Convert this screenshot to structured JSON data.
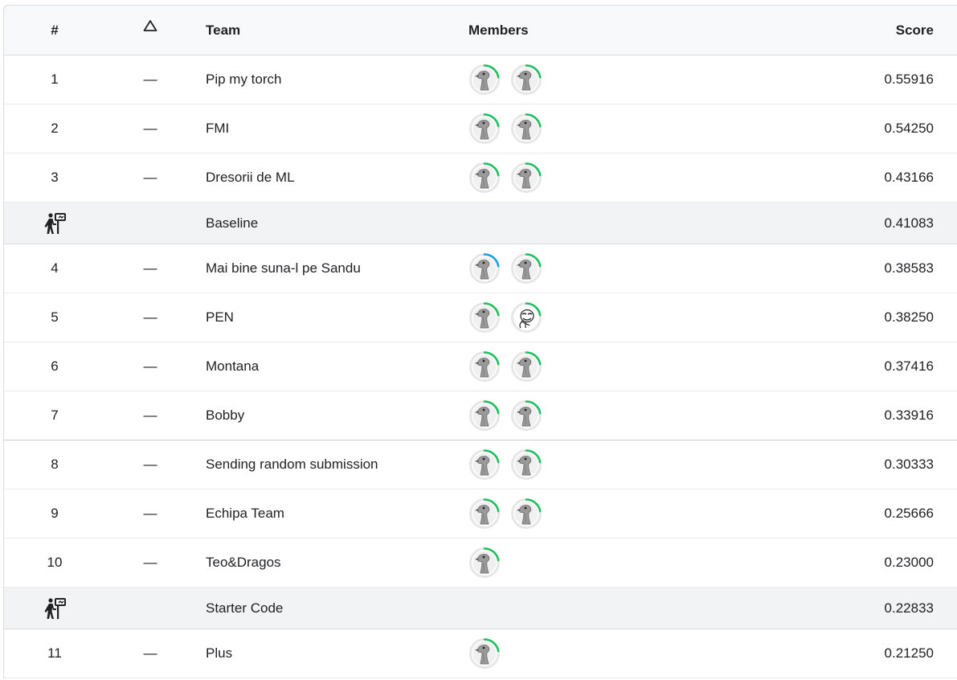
{
  "header": {
    "rank": "#",
    "delta_icon": "triangle-up-icon",
    "team": "Team",
    "members": "Members",
    "score": "Score"
  },
  "rows": [
    {
      "type": "team",
      "rank": "1",
      "delta": "—",
      "team": "Pip my torch",
      "score": "0.55916",
      "members": [
        {
          "icon": "bird-avatar",
          "ring": "#20c060"
        },
        {
          "icon": "bird-avatar",
          "ring": "#20c060"
        }
      ]
    },
    {
      "type": "team",
      "rank": "2",
      "delta": "—",
      "team": "FMI",
      "score": "0.54250",
      "members": [
        {
          "icon": "bird-avatar",
          "ring": "#20c060"
        },
        {
          "icon": "bird-avatar",
          "ring": "#20c060"
        }
      ]
    },
    {
      "type": "team",
      "rank": "3",
      "delta": "—",
      "team": "Dresorii de ML",
      "score": "0.43166",
      "members": [
        {
          "icon": "bird-avatar",
          "ring": "#20c060"
        },
        {
          "icon": "bird-avatar",
          "ring": "#20c060"
        }
      ]
    },
    {
      "type": "benchmark",
      "icon": "benchmark-icon",
      "team": "Baseline",
      "score": "0.41083"
    },
    {
      "type": "team",
      "rank": "4",
      "delta": "—",
      "team": "Mai bine suna-l pe Sandu",
      "score": "0.38583",
      "members": [
        {
          "icon": "bird-avatar",
          "ring": "#1ba1e2"
        },
        {
          "icon": "bird-avatar",
          "ring": "#20c060"
        }
      ]
    },
    {
      "type": "team",
      "rank": "5",
      "delta": "—",
      "team": "PEN",
      "score": "0.38250",
      "members": [
        {
          "icon": "bird-avatar",
          "ring": "#20c060"
        },
        {
          "icon": "meme-face-avatar",
          "ring": "#20c060"
        }
      ]
    },
    {
      "type": "team",
      "rank": "6",
      "delta": "—",
      "team": "Montana",
      "score": "0.37416",
      "members": [
        {
          "icon": "bird-avatar",
          "ring": "#20c060"
        },
        {
          "icon": "bird-avatar",
          "ring": "#20c060"
        }
      ]
    },
    {
      "type": "team",
      "rank": "7",
      "delta": "—",
      "team": "Bobby",
      "score": "0.33916",
      "members": [
        {
          "icon": "bird-avatar",
          "ring": "#20c060"
        },
        {
          "icon": "bird-avatar",
          "ring": "#20c060"
        }
      ]
    },
    {
      "type": "team",
      "rank": "8",
      "delta": "—",
      "team": "Sending random submission",
      "score": "0.30333",
      "members": [
        {
          "icon": "bird-avatar",
          "ring": "#20c060"
        },
        {
          "icon": "bird-avatar",
          "ring": "#20c060"
        }
      ]
    },
    {
      "type": "team",
      "rank": "9",
      "delta": "—",
      "team": "Echipa Team",
      "score": "0.25666",
      "members": [
        {
          "icon": "bird-avatar",
          "ring": "#20c060"
        },
        {
          "icon": "bird-avatar",
          "ring": "#20c060"
        }
      ]
    },
    {
      "type": "team",
      "rank": "10",
      "delta": "—",
      "team": "Teo&Dragos",
      "score": "0.23000",
      "members": [
        {
          "icon": "bird-avatar",
          "ring": "#20c060"
        }
      ]
    },
    {
      "type": "benchmark",
      "icon": "benchmark-icon",
      "team": "Starter Code",
      "score": "0.22833"
    },
    {
      "type": "team",
      "rank": "11",
      "delta": "—",
      "team": "Plus",
      "score": "0.21250",
      "members": [
        {
          "icon": "bird-avatar",
          "ring": "#20c060"
        }
      ]
    }
  ]
}
